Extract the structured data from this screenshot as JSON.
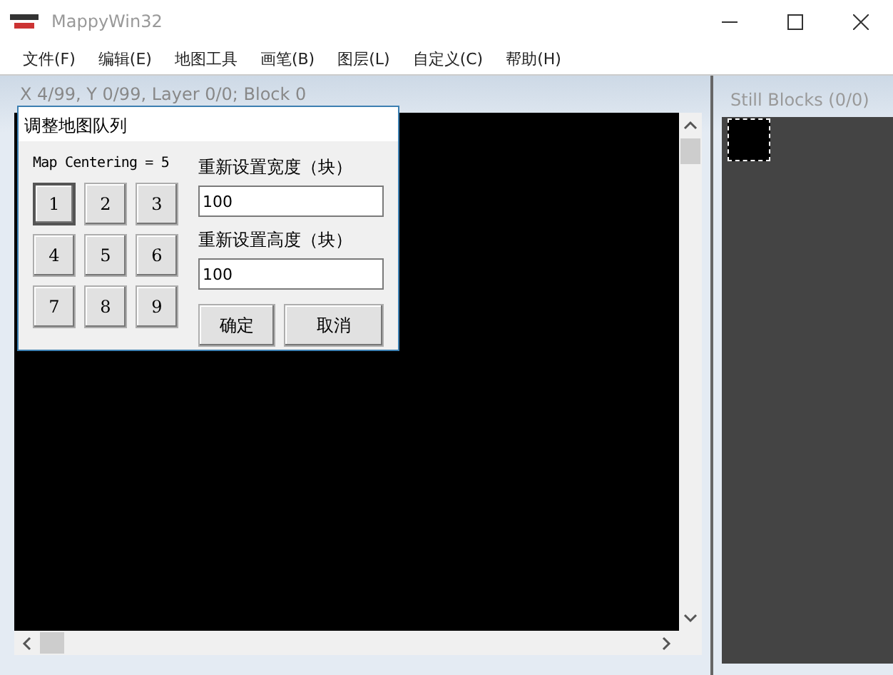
{
  "window": {
    "title": "MappyWin32"
  },
  "menu": [
    "文件(F)",
    "编辑(E)",
    "地图工具",
    "画笔(B)",
    "图层(L)",
    "自定义(C)",
    "帮助(H)"
  ],
  "map_panel": {
    "status": "X 4/99, Y 0/99, Layer 0/0; Block 0"
  },
  "blocks_panel": {
    "title": "Still Blocks (0/0)"
  },
  "dialog": {
    "title": "调整地图队列",
    "centering_label": "Map Centering = 5",
    "centering_buttons": [
      {
        "label": "1",
        "selected": true
      },
      {
        "label": "2",
        "selected": false
      },
      {
        "label": "3",
        "selected": false
      },
      {
        "label": "4",
        "selected": false
      },
      {
        "label": "5",
        "selected": false
      },
      {
        "label": "6",
        "selected": false
      },
      {
        "label": "7",
        "selected": false
      },
      {
        "label": "8",
        "selected": false
      },
      {
        "label": "9",
        "selected": false
      }
    ],
    "width_label": "重新设置宽度（块）",
    "width_value": "100",
    "height_label": "重新设置高度（块）",
    "height_value": "100",
    "buttons": [
      "确定",
      "取消"
    ]
  }
}
